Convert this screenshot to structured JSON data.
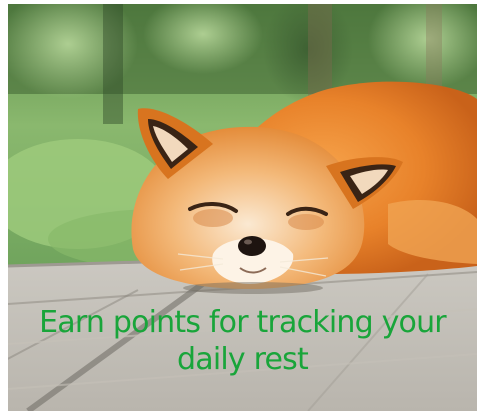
{
  "promo": {
    "caption": "Earn points for tracking your daily rest",
    "caption_color": "#19a53a"
  },
  "image": {
    "subject": "fox-sleeping-on-wooden-deck"
  }
}
